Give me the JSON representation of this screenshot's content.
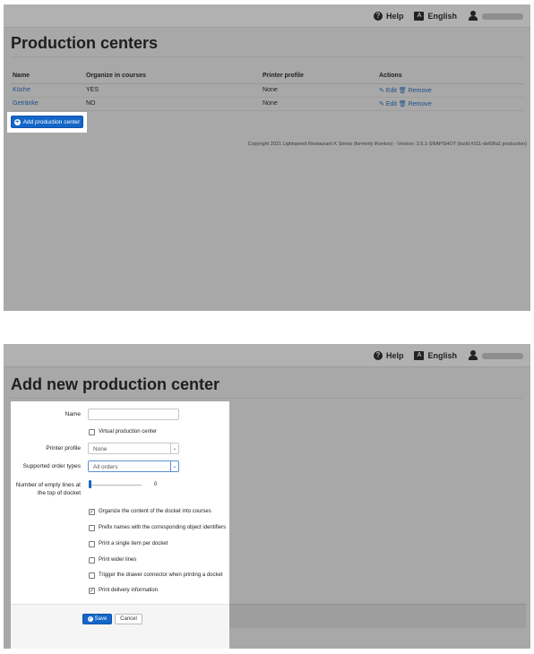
{
  "topbar": {
    "help_label": "Help",
    "language_label": "English",
    "help_icon_glyph": "?",
    "language_icon_glyph": "A"
  },
  "production_centers": {
    "title": "Production centers",
    "columns": [
      "Name",
      "Organize in courses",
      "Printer profile",
      "Actions"
    ],
    "rows": [
      {
        "name": "Küche",
        "organize": "YES",
        "printer": "None",
        "edit": "Edit",
        "remove": "Remove"
      },
      {
        "name": "Getränke",
        "organize": "NO",
        "printer": "None",
        "edit": "Edit",
        "remove": "Remove"
      }
    ],
    "add_button_label": "Add production center",
    "copyright": "Copyright 2021 Lightspeed Restaurant K Series (formerly iKentoo) - Version: 3.5.1-SNAPSHOT (build #311-de69fa1 production)"
  },
  "add_form": {
    "title": "Add new production center",
    "name_label": "Name",
    "name_value": "",
    "virtual_label": "Virtual production center",
    "virtual_checked": false,
    "printer_profile_label": "Printer profile",
    "printer_profile_value": "None",
    "order_types_label": "Supported order types",
    "order_types_value": "All orders",
    "empty_lines_label": "Number of empty lines at the top of docket",
    "empty_lines_value": "0",
    "checkboxes": [
      {
        "label": "Organize the content of the docket into courses",
        "checked": true
      },
      {
        "label": "Prefix names with the corresponding object identifiers",
        "checked": false
      },
      {
        "label": "Print a single item per docket",
        "checked": false
      },
      {
        "label": "Print wider lines",
        "checked": false
      },
      {
        "label": "Trigger the drawer connector when printing a docket",
        "checked": false
      },
      {
        "label": "Print delivery information",
        "checked": true
      }
    ],
    "save_label": "Save",
    "cancel_label": "Cancel"
  },
  "colors": {
    "primary": "#1466c8",
    "link": "#1d4e89",
    "overlay": "#a8a8a8"
  }
}
